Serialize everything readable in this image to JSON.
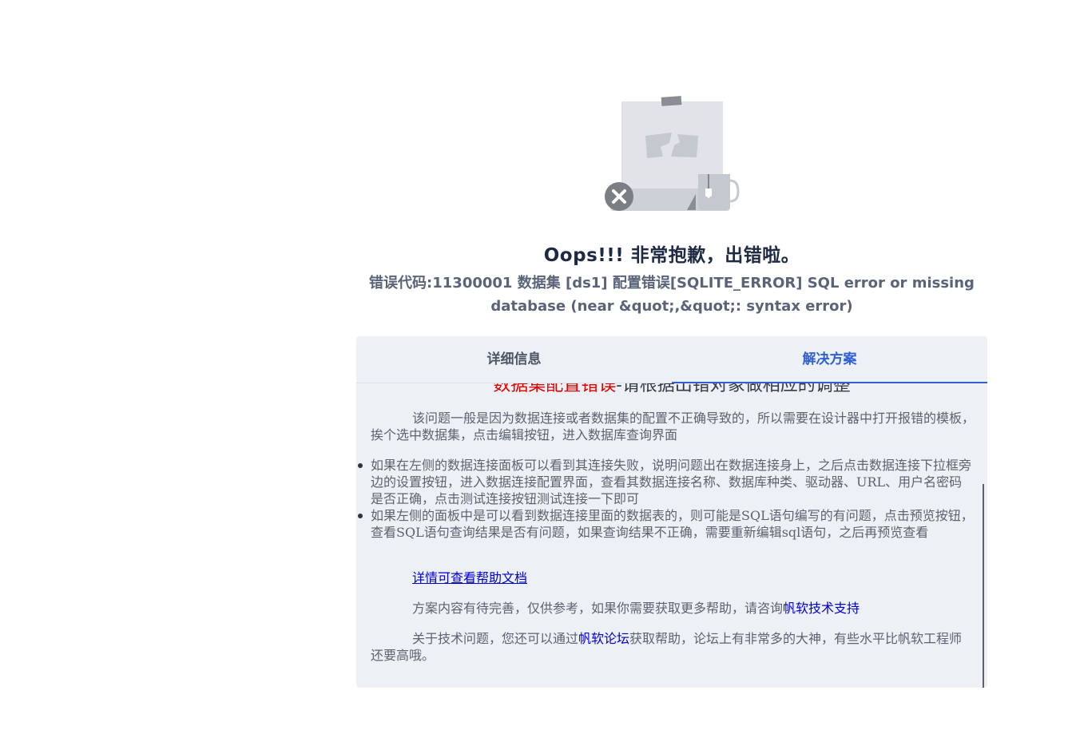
{
  "error_page": {
    "title": "Oops!!! 非常抱歉，出错啦。",
    "message": "错误代码:11300001 数据集 [ds1] 配置错误[SQLITE_ERROR] SQL error or missing database (near &quot;,&quot;: syntax error)"
  },
  "tabs": [
    {
      "label": "详细信息",
      "active": false
    },
    {
      "label": "解决方案",
      "active": true
    }
  ],
  "solution": {
    "heading_red": "数据集配置错误",
    "heading_rest": "-请根据出错对象做相应的调整",
    "para1": "该问题一般是因为数据连接或者数据集的配置不正确导致的，所以需要在设计器中打开报错的模板，挨个选中数据集，点击编辑按钮，进入数据库查询界面",
    "bullets": [
      "如果在左侧的数据连接面板可以看到其连接失败，说明问题出在数据连接身上，之后点击数据连接下拉框旁边的设置按钮，进入数据连接配置界面，查看其数据连接名称、数据库种类、驱动器、URL、用户名密码是否正确，点击测试连接按钮测试连接一下即可",
      "如果左侧的面板中是可以看到数据连接里面的数据表的，则可能是SQL语句编写的有问题，点击预览按钮，查看SQL语句查询结果是否有问题，如果查询结果不正确，需要重新编辑sql语句，之后再预览查看"
    ],
    "help_link": "详情可查看帮助文档",
    "para3_text": "方案内容有待完善，仅供参考，如果你需要获取更多帮助，请咨询",
    "para3_link": "帆软技术支持",
    "para4_before": "关于技术问题，您还可以通过",
    "para4_link": "帆软论坛",
    "para4_after": "获取帮助，论坛上有非常多的大神，有些水平比帆软工程师还要高哦。"
  },
  "colors": {
    "title": "#1e2a44",
    "message": "#5a6478",
    "active_tab": "#2f5fd0",
    "panel_bg": "#edf0f5",
    "heading_red": "#e00000",
    "link": "#0000cc"
  },
  "icons": {
    "illustration": "broken-page-illustration",
    "error_badge": "close-circle-icon"
  }
}
